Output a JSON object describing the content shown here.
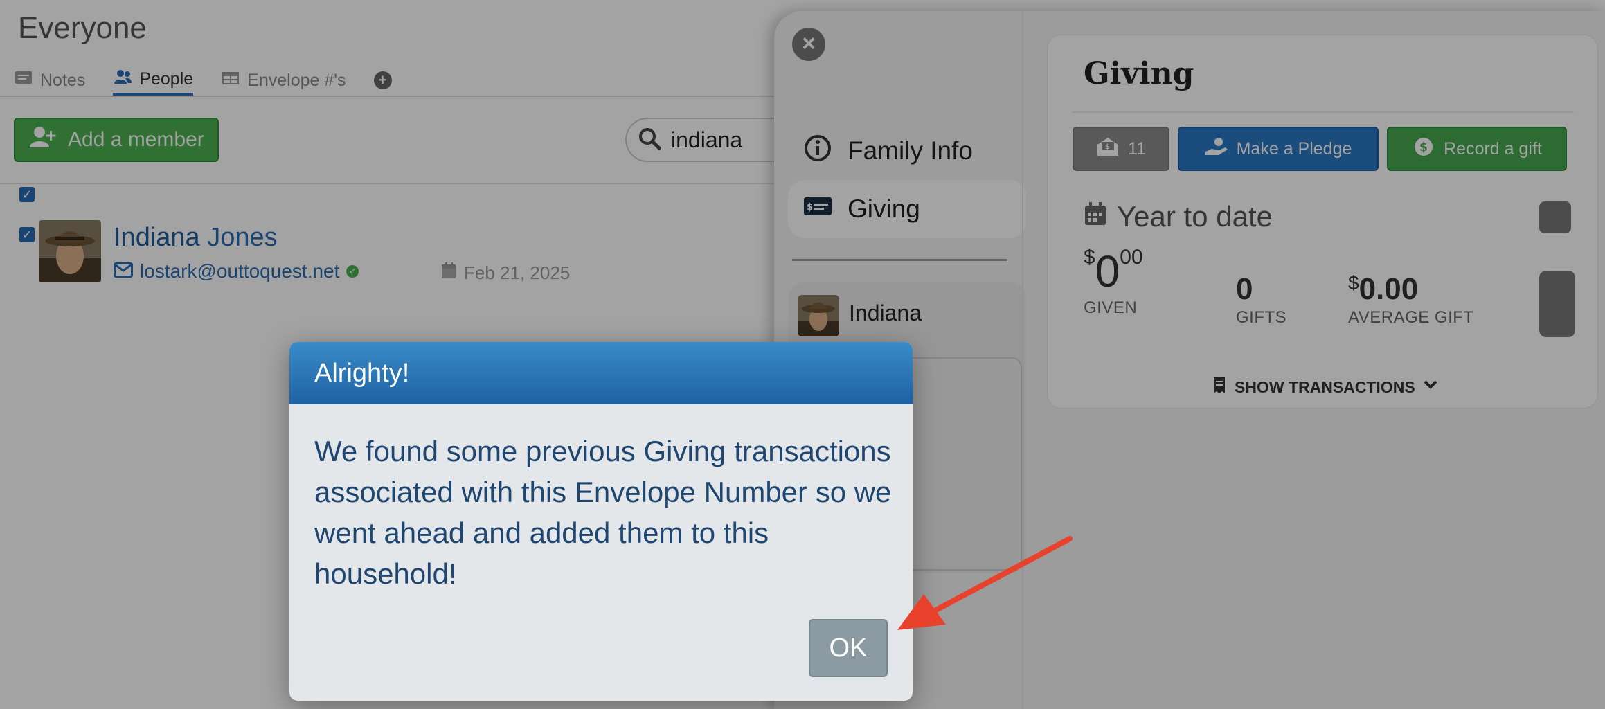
{
  "page": {
    "title": "Everyone",
    "tabs": [
      {
        "label": "Notes",
        "icon": "notes-icon"
      },
      {
        "label": "People",
        "icon": "people-icon",
        "active": true
      },
      {
        "label": "Envelope #'s",
        "icon": "table-icon"
      }
    ],
    "add_member_label": "Add a member",
    "search_value": "indiana"
  },
  "person": {
    "first_name": "Indiana",
    "last_name": "Jones",
    "email": "lostark@outtoquest.net",
    "date": "Feb 21, 2025"
  },
  "drawer": {
    "nav": [
      {
        "label": "Family Info",
        "icon": "info-icon"
      },
      {
        "label": "Giving",
        "icon": "money-card-icon"
      }
    ],
    "member_name": "Indiana",
    "giving": {
      "title": "Giving",
      "envelope_count": "11",
      "pledge_label": "Make a Pledge",
      "record_label": "Record a gift",
      "ytd_title": "Year to date",
      "given_currency": "$",
      "given_whole": "0",
      "given_cents": "00",
      "given_label": "GIVEN",
      "gifts_value": "0",
      "gifts_label": "GIFTS",
      "avg_currency": "$",
      "avg_value": "0.00",
      "avg_label": "AVERAGE GIFT",
      "show_transactions": "SHOW TRANSACTIONS"
    }
  },
  "modal": {
    "title": "Alrighty!",
    "message": "We found some previous Giving transactions associated with this Envelope Number so we went ahead and added them to this household!",
    "ok_label": "OK"
  },
  "colors": {
    "primary_blue": "#2a78c5",
    "success_green": "#45a94f",
    "modal_header": "#2a78c5",
    "annotation_arrow": "#e8412c"
  }
}
